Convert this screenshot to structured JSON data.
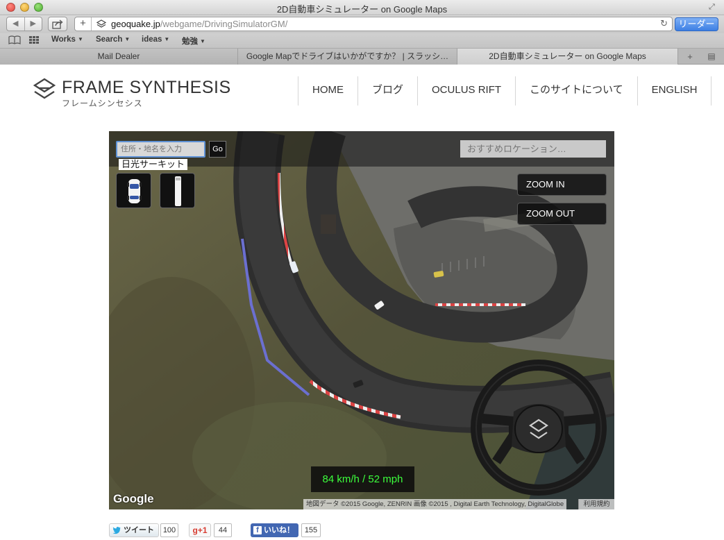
{
  "window": {
    "title": "2D自動車シミュレーター on Google Maps"
  },
  "toolbar": {
    "back_icon": "◀",
    "forward_icon": "▶",
    "share_icon": "share-icon",
    "url_host": "geoquake.jp",
    "url_path": "/webgame/DrivingSimulatorGM/",
    "reader_label": "リーダー"
  },
  "bookmarks": {
    "items": [
      {
        "label": "Works"
      },
      {
        "label": "Search"
      },
      {
        "label": "ideas"
      },
      {
        "label": "勉強"
      }
    ]
  },
  "tabs": [
    {
      "label": "Mail Dealer"
    },
    {
      "label": "Google Mapでドライブはいかがですか？ | スラッシ…"
    },
    {
      "label": "2D自動車シミュレーター on Google Maps"
    }
  ],
  "site": {
    "logo_text": "FRAME SYNTHESIS",
    "logo_sub": "フレームシンセシス",
    "nav": [
      {
        "label": "HOME"
      },
      {
        "label": "ブログ"
      },
      {
        "label": "OCULUS RIFT"
      },
      {
        "label": "このサイトについて"
      },
      {
        "label": "ENGLISH"
      }
    ]
  },
  "map": {
    "address_placeholder": "住所・地名を入力",
    "go_label": "Go",
    "place_label": "日光サーキット",
    "recommend_placeholder": "おすすめロケーション…",
    "zoom_in_label": "ZOOM IN",
    "zoom_out_label": "ZOOM OUT",
    "speed_text": "84 km/h /  52 mph",
    "google_logo": "Google",
    "credits": "地図データ ©2015 Google, ZENRIN 画像 ©2015 , Digital Earth Technology, DigitalGlobe",
    "terms": "利用規約"
  },
  "social": {
    "tweet_label": "ツイート",
    "tweet_count": "100",
    "gplus_label": "g+1",
    "gplus_count": "44",
    "like_label": "いいね！",
    "like_count": "155"
  }
}
